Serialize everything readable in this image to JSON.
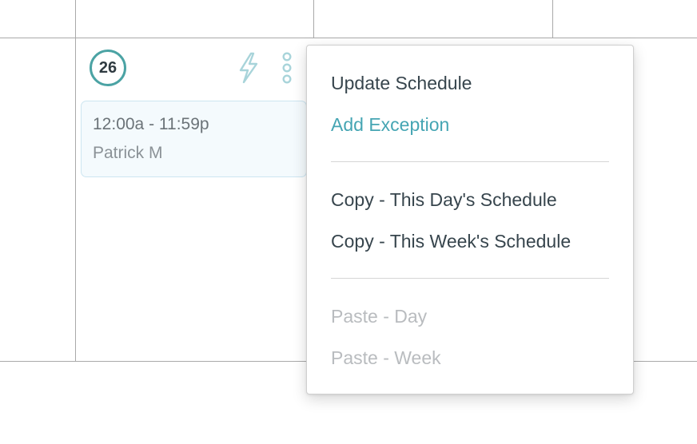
{
  "calendar": {
    "day_number": "26",
    "icons": {
      "quick_action": "lightning-bolt-icon",
      "more_options": "vertical-ellipsis-icon"
    },
    "shift": {
      "time": "12:00a - 11:59p",
      "person": "Patrick M"
    }
  },
  "context_menu": {
    "update_schedule": "Update Schedule",
    "add_exception": "Add Exception",
    "copy_day": "Copy - This Day's Schedule",
    "copy_week": "Copy - This Week's Schedule",
    "paste_day": "Paste - Day",
    "paste_week": "Paste - Week"
  },
  "colors": {
    "accent": "#45a5b3",
    "text_dark": "#37454d",
    "text_disabled": "#b9bcbf",
    "card_background": "#f4fafd",
    "card_border": "#cde6f1",
    "grid_line": "#a9a9a9"
  }
}
